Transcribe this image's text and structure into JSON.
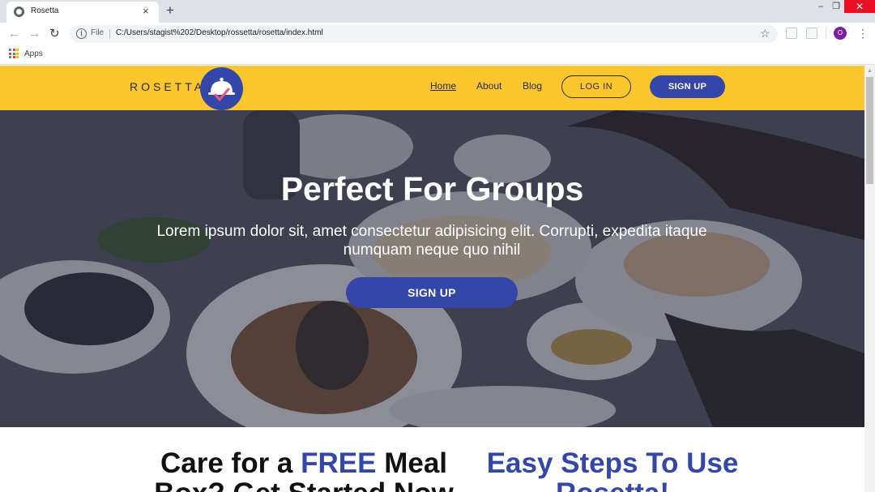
{
  "browser": {
    "tab_title": "Rosetta",
    "tab_close": "×",
    "new_tab": "+",
    "window_min": "–",
    "window_max": "❐",
    "window_close": "✕",
    "nav_back": "←",
    "nav_forward": "→",
    "nav_reload": "↻",
    "omnibox_label": "File",
    "url": "C:/Users/stagist%202/Desktop/rossetta/rosetta/index.html",
    "star": "☆",
    "profile_initial": "O",
    "menu": "⋮",
    "bookmark_apps": "Apps"
  },
  "site": {
    "brand": "ROSETTA",
    "nav": {
      "home": "Home",
      "about": "About",
      "blog": "Blog",
      "login": "LOG IN",
      "signup": "SIGN UP"
    },
    "hero": {
      "title": "Perfect For Groups",
      "subtitle": "Lorem ipsum dolor sit, amet consectetur adipisicing elit. Corrupti, expedita itaque numquam neque quo nihil",
      "cta": "SIGN UP"
    },
    "section": {
      "left_pre": "Care for a ",
      "left_highlight": "FREE",
      "left_post": " Meal Box? Get Started Now",
      "right": "Easy Steps To Use Rosetta!"
    }
  },
  "colors": {
    "nav_bg": "#fcc72e",
    "accent": "#3446a8",
    "close_red": "#e81123"
  },
  "icons": {
    "favicon": "globe-icon",
    "info": "info-icon",
    "logo": "cloche-check-icon"
  }
}
